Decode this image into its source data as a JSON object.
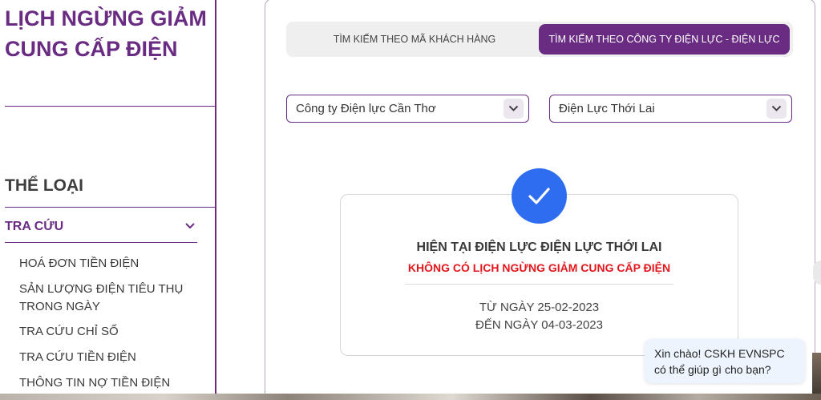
{
  "sidebar": {
    "title": "LỊCH NGỪNG GIẢM CUNG CẤP ĐIỆN",
    "category_heading": "THỂ LOẠI",
    "lookup": {
      "label": "TRA CỨU",
      "expanded": true,
      "items": [
        {
          "label": "HOÁ ĐƠN TIỀN ĐIỆN"
        },
        {
          "label": "SẢN LƯỢNG ĐIỆN TIÊU THỤ TRONG NGÀY"
        },
        {
          "label": "TRA CỨU CHỈ SỐ"
        },
        {
          "label": "TRA CỨU TIỀN ĐIỆN"
        },
        {
          "label": "THÔNG TIN NỢ TIỀN ĐIỆN"
        }
      ]
    }
  },
  "tabs": [
    {
      "label": "TÌM KIẾM THEO MÃ KHÁCH HÀNG",
      "active": false
    },
    {
      "label": "TÌM KIẾM THEO CÔNG TY ĐIỆN LỰC - ĐIỆN LỰC",
      "active": true
    }
  ],
  "filters": {
    "company": "Công ty Điện lực Cần Thơ",
    "branch": "Điện Lực Thới Lai"
  },
  "result": {
    "title": "HIỆN TẠI ĐIỆN LỰC ĐIỆN LỰC THỚI LAI",
    "subtitle": "KHÔNG CÓ LỊCH NGỪNG GIẢM CUNG CẤP ĐIỆN",
    "from": "TỪ NGÀY 25-02-2023",
    "to": "ĐẾN NGÀY 04-03-2023"
  },
  "chat": {
    "line1": "Xin chào! CSKH EVNSPC",
    "line2": "có thể giúp gì cho bạn?"
  },
  "colors": {
    "brand_purple": "#6a2c83",
    "success_blue": "#2f6df0",
    "alert_red": "#e3161c"
  },
  "icons": {
    "lookup_toggle": "chevron-down-icon",
    "select_arrow": "chevron-down-icon",
    "result": "check-icon"
  }
}
